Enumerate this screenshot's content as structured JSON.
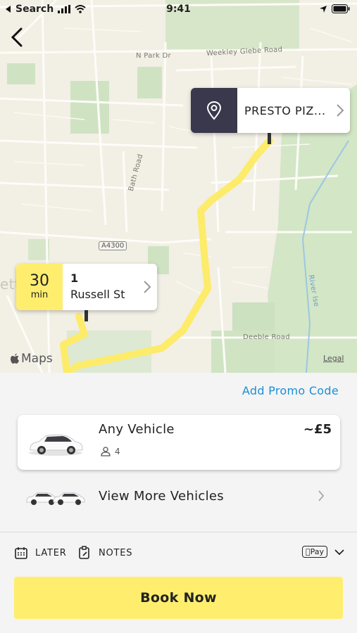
{
  "status_bar": {
    "back_app": "Search",
    "time": "9:41"
  },
  "map": {
    "road_labels": {
      "n_park_dr": "N Park Dr",
      "weekley_glebe": "Weekley Glebe Road",
      "bath_road": "Bath Road",
      "a4300": "A4300",
      "deeble_road": "Deeble Road",
      "river_ise": "River Ise",
      "place_fragment": "ett"
    },
    "maps_brand": "Maps",
    "legal": "Legal",
    "destination": {
      "name": "PRESTO PIZ...",
      "icon": "location-pin-icon"
    },
    "origin": {
      "eta_value": "30",
      "eta_unit": "min",
      "address_line1": "1",
      "address_line2": "Russell St"
    },
    "route_color": "#fdeb6a"
  },
  "sheet": {
    "promo_label": "Add Promo Code",
    "vehicle": {
      "name": "Any Vehicle",
      "seats": "4",
      "price": "~£5"
    },
    "more_vehicles_label": "View More Vehicles",
    "options": {
      "later": "LATER",
      "notes": "NOTES",
      "payment_badge": "Pay"
    },
    "book_button": "Book Now"
  },
  "colors": {
    "accent_yellow": "#ffee6e",
    "link_blue": "#1a8fd6",
    "pin_dark": "#3a384c"
  }
}
